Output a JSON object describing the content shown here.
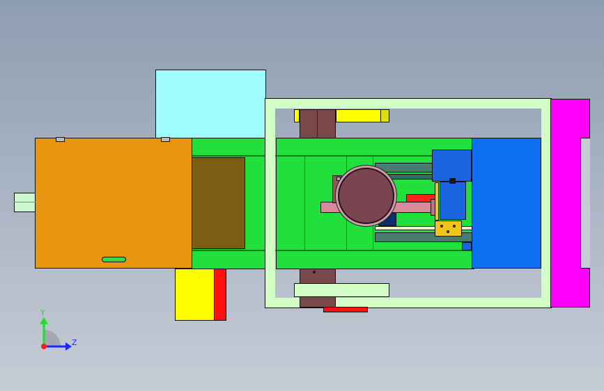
{
  "viewport": {
    "background_top": "#8e9db1",
    "background_bottom": "#c6ccd6"
  },
  "colors": {
    "cyan_block": "#9ffcff",
    "orange_cover": "#e8950f",
    "green_frame": "#22e03c",
    "light_green_frame": "#d2fdc4",
    "magenta_plate": "#ff00ff",
    "blue_block": "#0d6ff2",
    "yellow_block": "#ffff00",
    "red_block": "#ff1010",
    "brown_column": "#7a4848",
    "olive_plate": "#7a5e12",
    "teal_bar": "#4a7b70",
    "motor_disk": "#7a4450",
    "shaft_pink": "#d98a9a"
  },
  "triad": {
    "y_label": "Y",
    "z_label": "Z",
    "y_color": "#1ee01e",
    "z_color": "#1a2bff",
    "x_color": "#ff1a1a"
  }
}
